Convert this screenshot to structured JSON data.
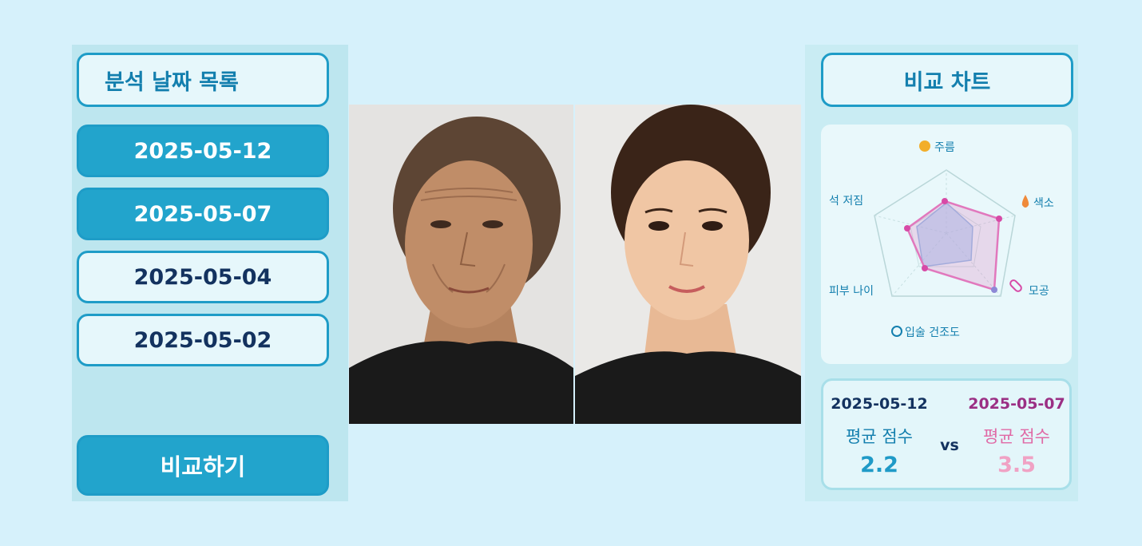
{
  "left_panel": {
    "title": "분석 날짜 목록",
    "dates": [
      {
        "label": "2025-05-12",
        "state": "active"
      },
      {
        "label": "2025-05-07",
        "state": "active"
      },
      {
        "label": "2025-05-04",
        "state": "inactive"
      },
      {
        "label": "2025-05-02",
        "state": "inactive"
      }
    ],
    "compare_button": "비교하기"
  },
  "right_panel": {
    "title": "비교 차트",
    "radar": {
      "axes": [
        "주름",
        "색소",
        "모공",
        "입술 건조도",
        "피부 나이",
        "석 저짐"
      ],
      "series_colors": [
        "#9cc8ef",
        "#e178bd"
      ]
    },
    "scores": {
      "before": {
        "date": "2025-05-12",
        "label": "평균 점수",
        "value": "2.2"
      },
      "vs": "vs",
      "after": {
        "date": "2025-05-07",
        "label": "평균 점수",
        "value": "3.5"
      }
    }
  },
  "colors": {
    "accent": "#22a4cc",
    "background": "#d6f1fb",
    "panel": "#bde6ef"
  }
}
